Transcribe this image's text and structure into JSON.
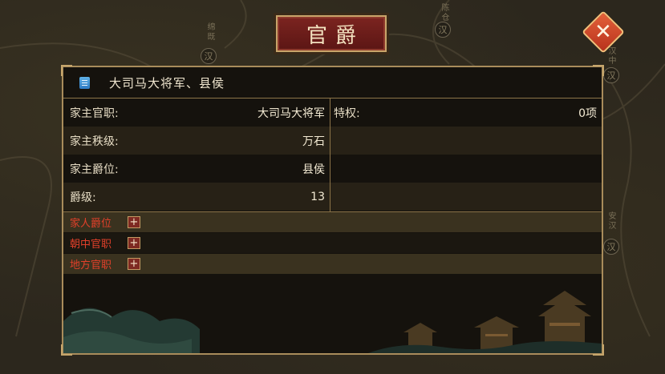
{
  "title": "官爵",
  "close_icon": "close-icon",
  "map": {
    "cities": [
      "绵既",
      "陈仓",
      "汉中",
      "安汉"
    ],
    "marker_label": "汉"
  },
  "header": {
    "icon": "document-icon",
    "text": "大司马大将军、县侯"
  },
  "stats_left": [
    {
      "label": "家主官职:",
      "value": "大司马大将军"
    },
    {
      "label": "家主秩级:",
      "value": "万石"
    },
    {
      "label": "家主爵位:",
      "value": "县侯"
    },
    {
      "label": "爵级:",
      "value": "13"
    }
  ],
  "stats_right": [
    {
      "label": "特权:",
      "value": "0项"
    }
  ],
  "sections": [
    {
      "label": "家人爵位",
      "button": "+"
    },
    {
      "label": "朝中官职",
      "button": "+"
    },
    {
      "label": "地方官职",
      "button": "+"
    }
  ],
  "colors": {
    "accent_red": "#e2402a",
    "gold_border": "#a98c5b",
    "title_red": "#7c2420"
  }
}
